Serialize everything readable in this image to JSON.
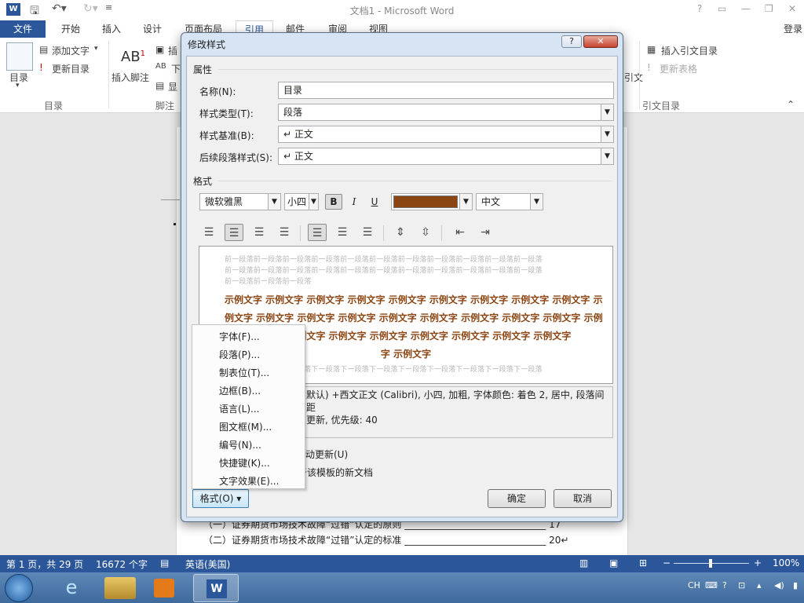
{
  "window": {
    "title": "文档1 - Microsoft Word",
    "help": "?",
    "signin": "登录"
  },
  "quick_access": {
    "save_icon": "save-icon",
    "undo_icon": "undo-icon",
    "redo_icon": "redo-icon"
  },
  "tabs": [
    "文件",
    "开始",
    "插入",
    "设计",
    "页面布局",
    "引用",
    "邮件",
    "审阅",
    "视图"
  ],
  "ribbon": {
    "toc_label": "目录",
    "add_text": "添加文字",
    "update_toc": "更新目录",
    "group_toc": "目录",
    "insert_footnote": "插入脚注",
    "footnote_group": "脚注",
    "insert_toa": "插入引文目录",
    "update_table": "更新表格",
    "citation_group": "引文目录",
    "citation": "引文",
    "ins_clip": "插",
    "next_clip": "下",
    "show_clip": "显"
  },
  "document": {
    "line1": "（一）证券期货市场技术故障“过错”认定的原则 ______________________________ 17",
    "line2": "（二）证券期货市场技术故障“过错”认定的标准 ______________________________ 20↵",
    "line1_clip": "（一）证券期货市场技术故障“过错”认定的原则"
  },
  "status": {
    "page": "第 1 页，共 29 页",
    "words": "16672 个字",
    "lang": "英语(美国)",
    "zoom": "100%",
    "minus": "−",
    "plus": "+"
  },
  "dialog": {
    "title": "修改样式",
    "section_props": "属性",
    "name_label": "名称(N):",
    "name_value": "目录",
    "type_label": "样式类型(T):",
    "type_value": "段落",
    "based_label": "样式基准(B):",
    "based_value": "↵ 正文",
    "next_label": "后续段落样式(S):",
    "next_value": "↵ 正文",
    "section_format": "格式",
    "font": "微软雅黑",
    "size": "小四",
    "bold": "B",
    "italic": "I",
    "underline": "U",
    "font_color": "#8b4513",
    "script": "中文",
    "preview_prev": [
      "前一段落前一段落前一段落前一段落前一段落前一段落前一段落前一段落前一段落前一段落前一段落",
      "前一段落前一段落前一段落前一段落前一段落前一段落前一段落前一段落前一段落前一段落前一段落",
      "前一段落前一段落前一段落"
    ],
    "preview_sample": [
      "示例文字 示例文字 示例文字 示例文字 示例文字 示例文字 示例文字 示例文字 示例文字 示",
      "例文字 示例文字 示例文字 示例文字 示例文字 示例文字 示例文字 示例文字 示例文字 示例",
      "文字 示例文字 示例文字 示例文字 示例文字 示例文字 示例文字 示例文字 示例文字",
      "字 示例文字"
    ],
    "preview_next": "下一段落下一段落下一段落下一段落下一段落下一段落下一段落下一段落下一段落下一段落下一段落",
    "desc_line1": "默认) +西文正文 (Calibri), 小四, 加粗, 字体颜色: 着色 2, 居中, 段落间距",
    "desc_line2": "更新, 优先级: 40",
    "auto_update": "动更新(U)",
    "new_docs": "于该模板的新文档",
    "format_button": "格式(O) ▾",
    "ok": "确定",
    "cancel": "取消",
    "help_btn": "?",
    "close_btn": "✕"
  },
  "format_menu": [
    "字体(F)...",
    "段落(P)...",
    "制表位(T)...",
    "边框(B)...",
    "语言(L)...",
    "图文框(M)...",
    "编号(N)...",
    "快捷键(K)...",
    "文字效果(E)..."
  ],
  "tray": {
    "ime": "CH"
  }
}
